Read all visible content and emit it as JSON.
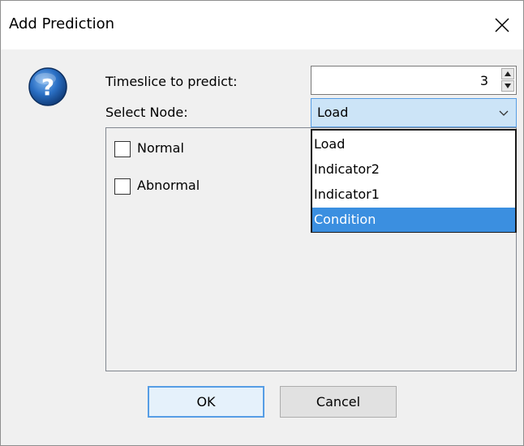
{
  "window": {
    "title": "Add Prediction"
  },
  "form": {
    "timeslice_label": "Timeslice to predict:",
    "timeslice_value": "3",
    "node_label": "Select Node:",
    "node_value": "Load"
  },
  "states": [
    {
      "label": "Normal",
      "checked": false
    },
    {
      "label": "Abnormal",
      "checked": false
    }
  ],
  "dropdown": {
    "options": [
      "Load",
      "Indicator2",
      "Indicator1",
      "Condition"
    ],
    "highlighted": "Condition"
  },
  "buttons": {
    "ok_label": "OK",
    "cancel_label": "Cancel"
  },
  "colors": {
    "selection": "#3b8fe0",
    "focus_border": "#569de5",
    "combo_background": "#cce4f7",
    "help_icon": "#1e5fb0"
  },
  "icons": {
    "help": "question-mark-icon",
    "close": "close-icon",
    "spin_up": "arrow-up-icon",
    "spin_down": "arrow-down-icon",
    "combo_arrow": "chevron-down-icon"
  }
}
